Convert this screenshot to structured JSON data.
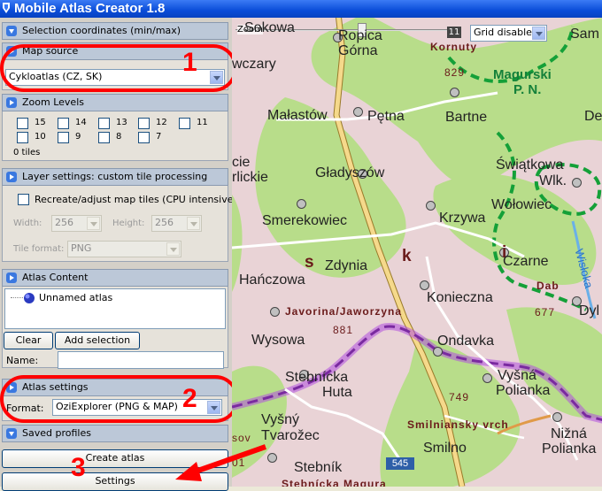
{
  "window": {
    "title": "Mobile Atlas Creator 1.8"
  },
  "sections": {
    "selection_coordinates": "Selection coordinates (min/max)",
    "map_source": "Map source",
    "zoom_levels": "Zoom Levels",
    "layer_settings": "Layer settings: custom tile processing",
    "atlas_content": "Atlas Content",
    "atlas_settings": "Atlas settings",
    "saved_profiles": "Saved profiles"
  },
  "map_source": {
    "selected": "Cykloatlas (CZ, SK)"
  },
  "zoom": {
    "levels": [
      "15",
      "14",
      "13",
      "12",
      "11",
      "10",
      "9",
      "8",
      "7"
    ],
    "tiles": "0 tiles"
  },
  "layer": {
    "recreate_label": "Recreate/adjust map tiles (CPU intensive)",
    "width_label": "Width:",
    "width_value": "256",
    "height_label": "Height:",
    "height_value": "256",
    "format_label": "Tile format:",
    "format_value": "PNG"
  },
  "atlas_content": {
    "tree_item": "Unnamed atlas",
    "clear": "Clear",
    "add_selection": "Add selection",
    "name_label": "Name:"
  },
  "atlas_settings": {
    "format_label": "Format:",
    "format_value": "OziExplorer (PNG & MAP)"
  },
  "buttons": {
    "create_atlas": "Create atlas",
    "settings": "Settings"
  },
  "annotations": {
    "one": "1",
    "two": "2",
    "three": "3"
  },
  "map_toolbar": {
    "zoom_label": "Zoom",
    "zoom_value": "11",
    "grid": "Grid disabled"
  },
  "map_labels": {
    "sokowa": "Sokowa",
    "ropica": "Ropica",
    "gorna": "Górna",
    "korniuty": "Kornuty",
    "e829": "829",
    "sam": "Sam",
    "owczary": "wczary",
    "magurski": "Magurski",
    "pn": "P. N.",
    "malastow": "Małastów",
    "petna": "Pętna",
    "bartne": "Bartne",
    "de": "De",
    "cie": "cie",
    "rlickie": "rlickie",
    "gladyszow": "Gładyszów",
    "swiatkowa": "Świątkowa",
    "wlk": "Wlk.",
    "krzywa": "Krzywa",
    "smerekowiec": "Smerekowiec",
    "wolowiec": "Wołowiec",
    "s": "s",
    "k": "k",
    "i": "i",
    "zdynia": "Zdynia",
    "czarne": "Czarne",
    "wisloka": "Wisłoka",
    "hanczowa": "Hańczowa",
    "konieczna": "Konieczna",
    "dab": "Dab",
    "e677": "677",
    "dyl": "Dyl",
    "javorina": "Javorina/Jaworzyna",
    "e881": "881",
    "wysowa": "Wysowa",
    "ondavka": "Ondavka",
    "stebnicka": "Stebnícka",
    "huta": "Huta",
    "vysna": "Vyšná",
    "polianka": "Polianka",
    "e749": "749",
    "vysny": "Vyšný",
    "tvarozec": "Tvarožec",
    "smilniansky": "Smilniansky vrch",
    "nizna": "Nižná",
    "polianka2": "Polianka",
    "sov": "sov",
    "e01": "01",
    "smilno": "Smilno",
    "stebnik": "Stebník",
    "road545": "545",
    "stebnicka_magura": "Stebnícka Magura"
  },
  "colors": {
    "red": "#ff0000",
    "park_border": "#14a038",
    "hiking_trail": "#b04fe0",
    "road": "#f5d98b"
  }
}
